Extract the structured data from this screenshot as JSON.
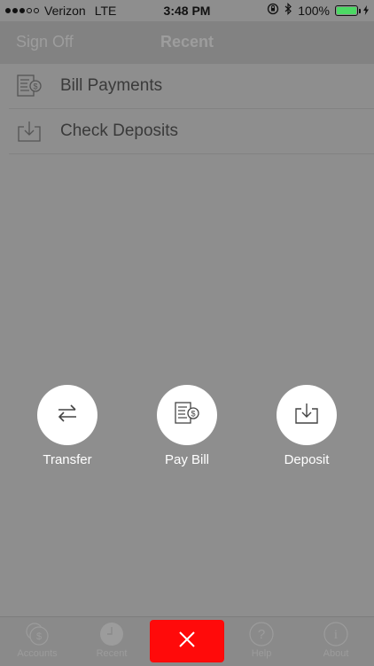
{
  "status_bar": {
    "carrier": "Verizon",
    "network": "LTE",
    "time": "3:48 PM",
    "battery_percent": "100%",
    "battery_level": 1.0,
    "signal_bars_filled": 3,
    "signal_bars_total": 5
  },
  "nav": {
    "sign_off_label": "Sign Off",
    "title": "Recent"
  },
  "list": {
    "items": [
      {
        "label": "Bill Payments",
        "icon": "bill-payment-icon"
      },
      {
        "label": "Check Deposits",
        "icon": "deposit-tray-icon"
      }
    ]
  },
  "actions": {
    "transfer_label": "Transfer",
    "pay_bill_label": "Pay Bill",
    "deposit_label": "Deposit"
  },
  "tab_bar": {
    "tabs": [
      {
        "label": "Accounts",
        "icon": "dollar-coins-icon"
      },
      {
        "label": "Recent",
        "icon": "clock-icon"
      },
      {
        "label": "Help",
        "icon": "question-icon"
      },
      {
        "label": "About",
        "icon": "info-icon"
      }
    ],
    "close_icon": "close-x-icon"
  },
  "colors": {
    "overlay_background": "#8e8e8e",
    "close_button": "#ff0a0a",
    "battery_fill": "#4cd964"
  }
}
